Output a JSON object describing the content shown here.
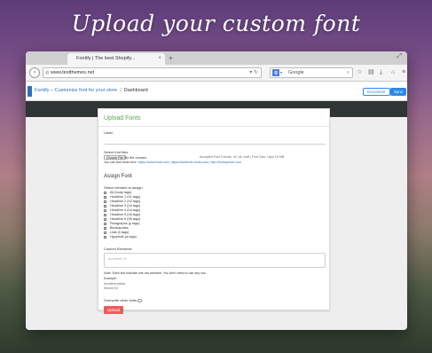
{
  "hero": {
    "title": "Upload your custom font"
  },
  "browser": {
    "tab_title": "Fontify | The best Shopify...",
    "tab_close": "×",
    "new_tab": "+",
    "url": "www.testthemes.net",
    "search_placeholder": "Google",
    "search_engine_letter": "g",
    "icons": [
      "back-icon",
      "globe-icon",
      "star-icon",
      "reader-icon",
      "download-icon",
      "home-icon",
      "menu-icon",
      "resize-icon"
    ]
  },
  "app": {
    "breadcrumb_app": "Fontify – Customize font for your store",
    "breadcrumb_sep": "/",
    "breadcrumb_page": "Dashboard",
    "document_button": "Document",
    "sync_button": "Sync",
    "accent": "#2d87e6"
  },
  "upload": {
    "title": "Upload Fonts",
    "label_caption": "Label",
    "select_files_caption": "Select font files",
    "choose_file": "Choose File",
    "no_file": "No file chosen",
    "format_info": "Accepted Font Format : ttf, otf, woff | Font Size: Upto 15 MB",
    "find_fonts_prefix": "You can find fonts here:",
    "find_fonts_links": "https://www.fonts.com, https://webfonts.fonts.com/, http://fontsquirrel.com"
  },
  "assign": {
    "title": "Assign Font",
    "select_caption": "Select element to assign",
    "options": [
      "All (body tags)",
      "Headline 1 (h1 tags)",
      "Headline 2 (h2 tags)",
      "Headline 3 (h3 tags)",
      "Headline 4 (h4 tags)",
      "Headline 5 (h5 tags)",
      "Headline 6 (h6 tags)",
      "Paragraphs (p tags)",
      "Blockquotes",
      "Lists (li tags)",
      "Hyperlink (a tags)"
    ],
    "custom_caption": "Custom Elements",
    "custom_placeholder": "#content h3",
    "note_label": "Note:",
    "note_text": "Each line indicate one css element. You don't need to use any css.",
    "example_label": "Example:",
    "example_line1": "#content article",
    "example_line2": "#home h3",
    "overwrite_label": "Overwrite other fonts",
    "upload_button": "Upload",
    "upload_color": "#f05a5a"
  }
}
